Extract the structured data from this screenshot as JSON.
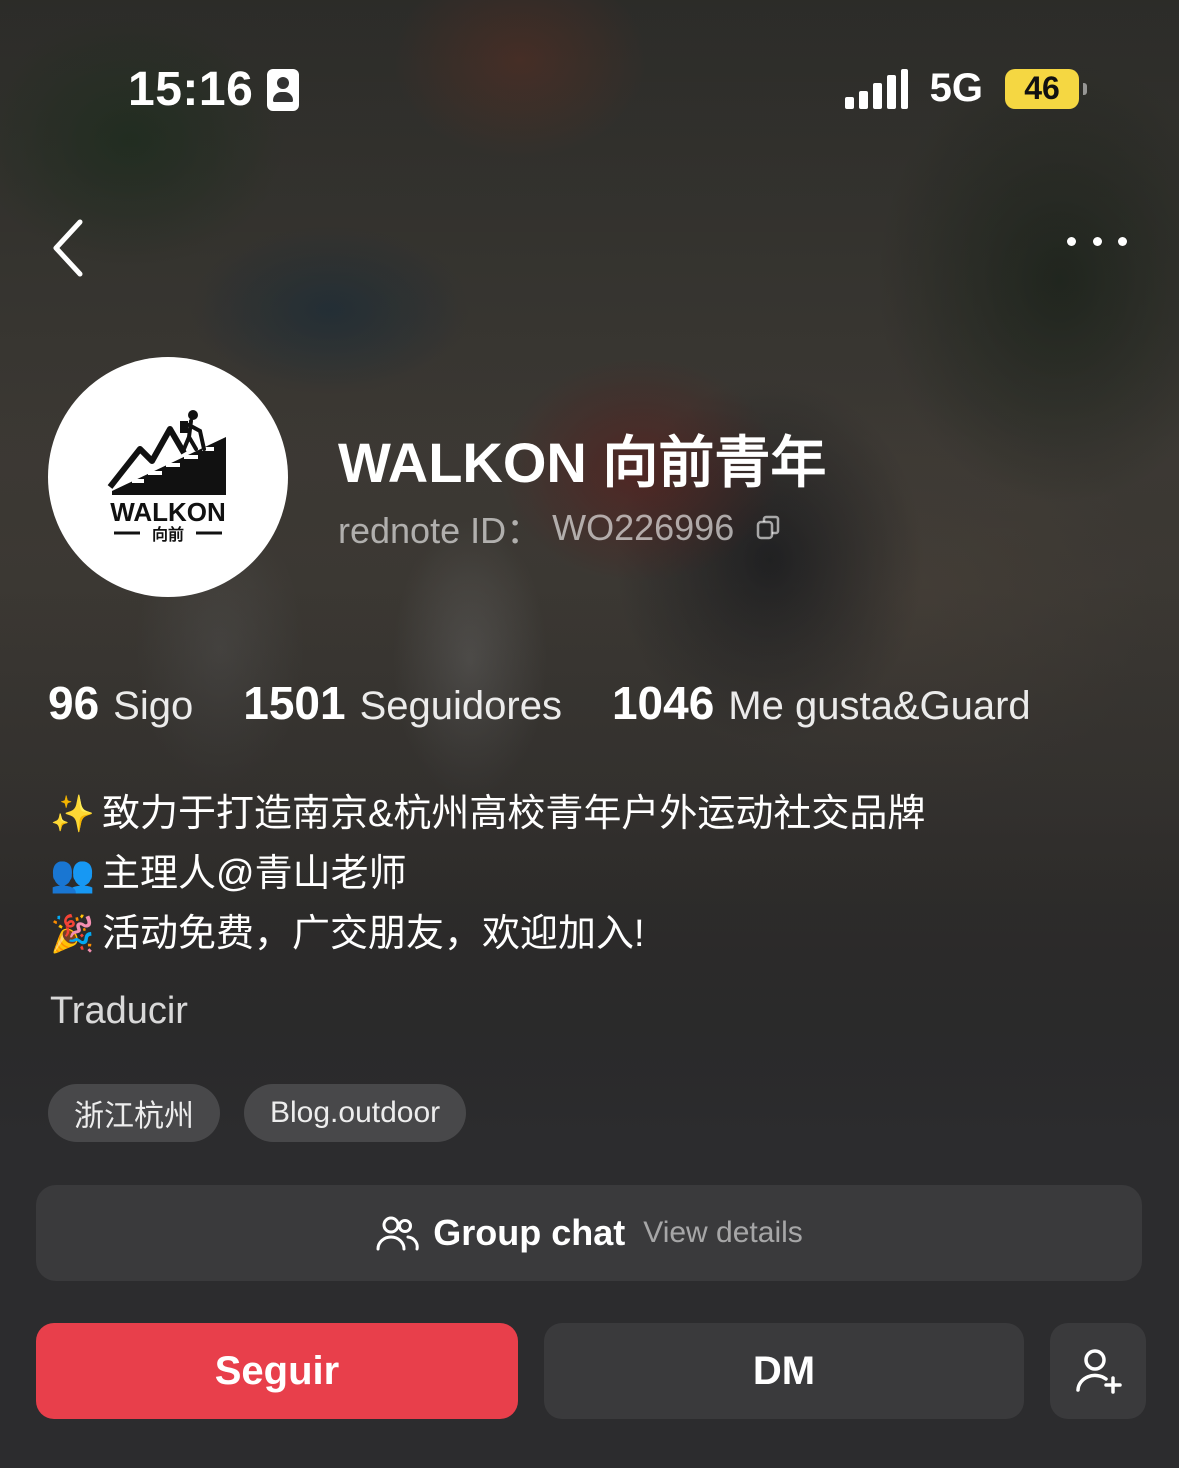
{
  "status_bar": {
    "time": "15:16",
    "network": "5G",
    "battery": "46",
    "battery_color": "#f5d742"
  },
  "nav": {
    "back_icon": "chevron-left-icon",
    "more_icon": "more-horizontal-icon"
  },
  "profile": {
    "avatar_logo_text": "WALKON",
    "avatar_logo_subtext": "向前",
    "name": "WALKON 向前青年",
    "id_label": "rednote ID：",
    "id_value": "WO226996"
  },
  "stats": [
    {
      "value": "96",
      "label": "Sigo"
    },
    {
      "value": "1501",
      "label": "Seguidores"
    },
    {
      "value": "1046",
      "label": "Me gusta&Guard"
    }
  ],
  "bio": [
    {
      "emoji": "✨",
      "text": "致力于打造南京&杭州高校青年户外运动社交品牌"
    },
    {
      "emoji": "👥",
      "text": "主理人@青山老师"
    },
    {
      "emoji": "🎉",
      "text": "活动免费，广交朋友，欢迎加入!"
    }
  ],
  "translate_label": "Traducir",
  "tags": [
    "浙江杭州",
    "Blog.outdoor"
  ],
  "group_chat": {
    "label": "Group chat",
    "detail": "View details"
  },
  "actions": {
    "follow_label": "Seguir",
    "dm_label": "DM",
    "follow_color": "#e83f4b"
  }
}
